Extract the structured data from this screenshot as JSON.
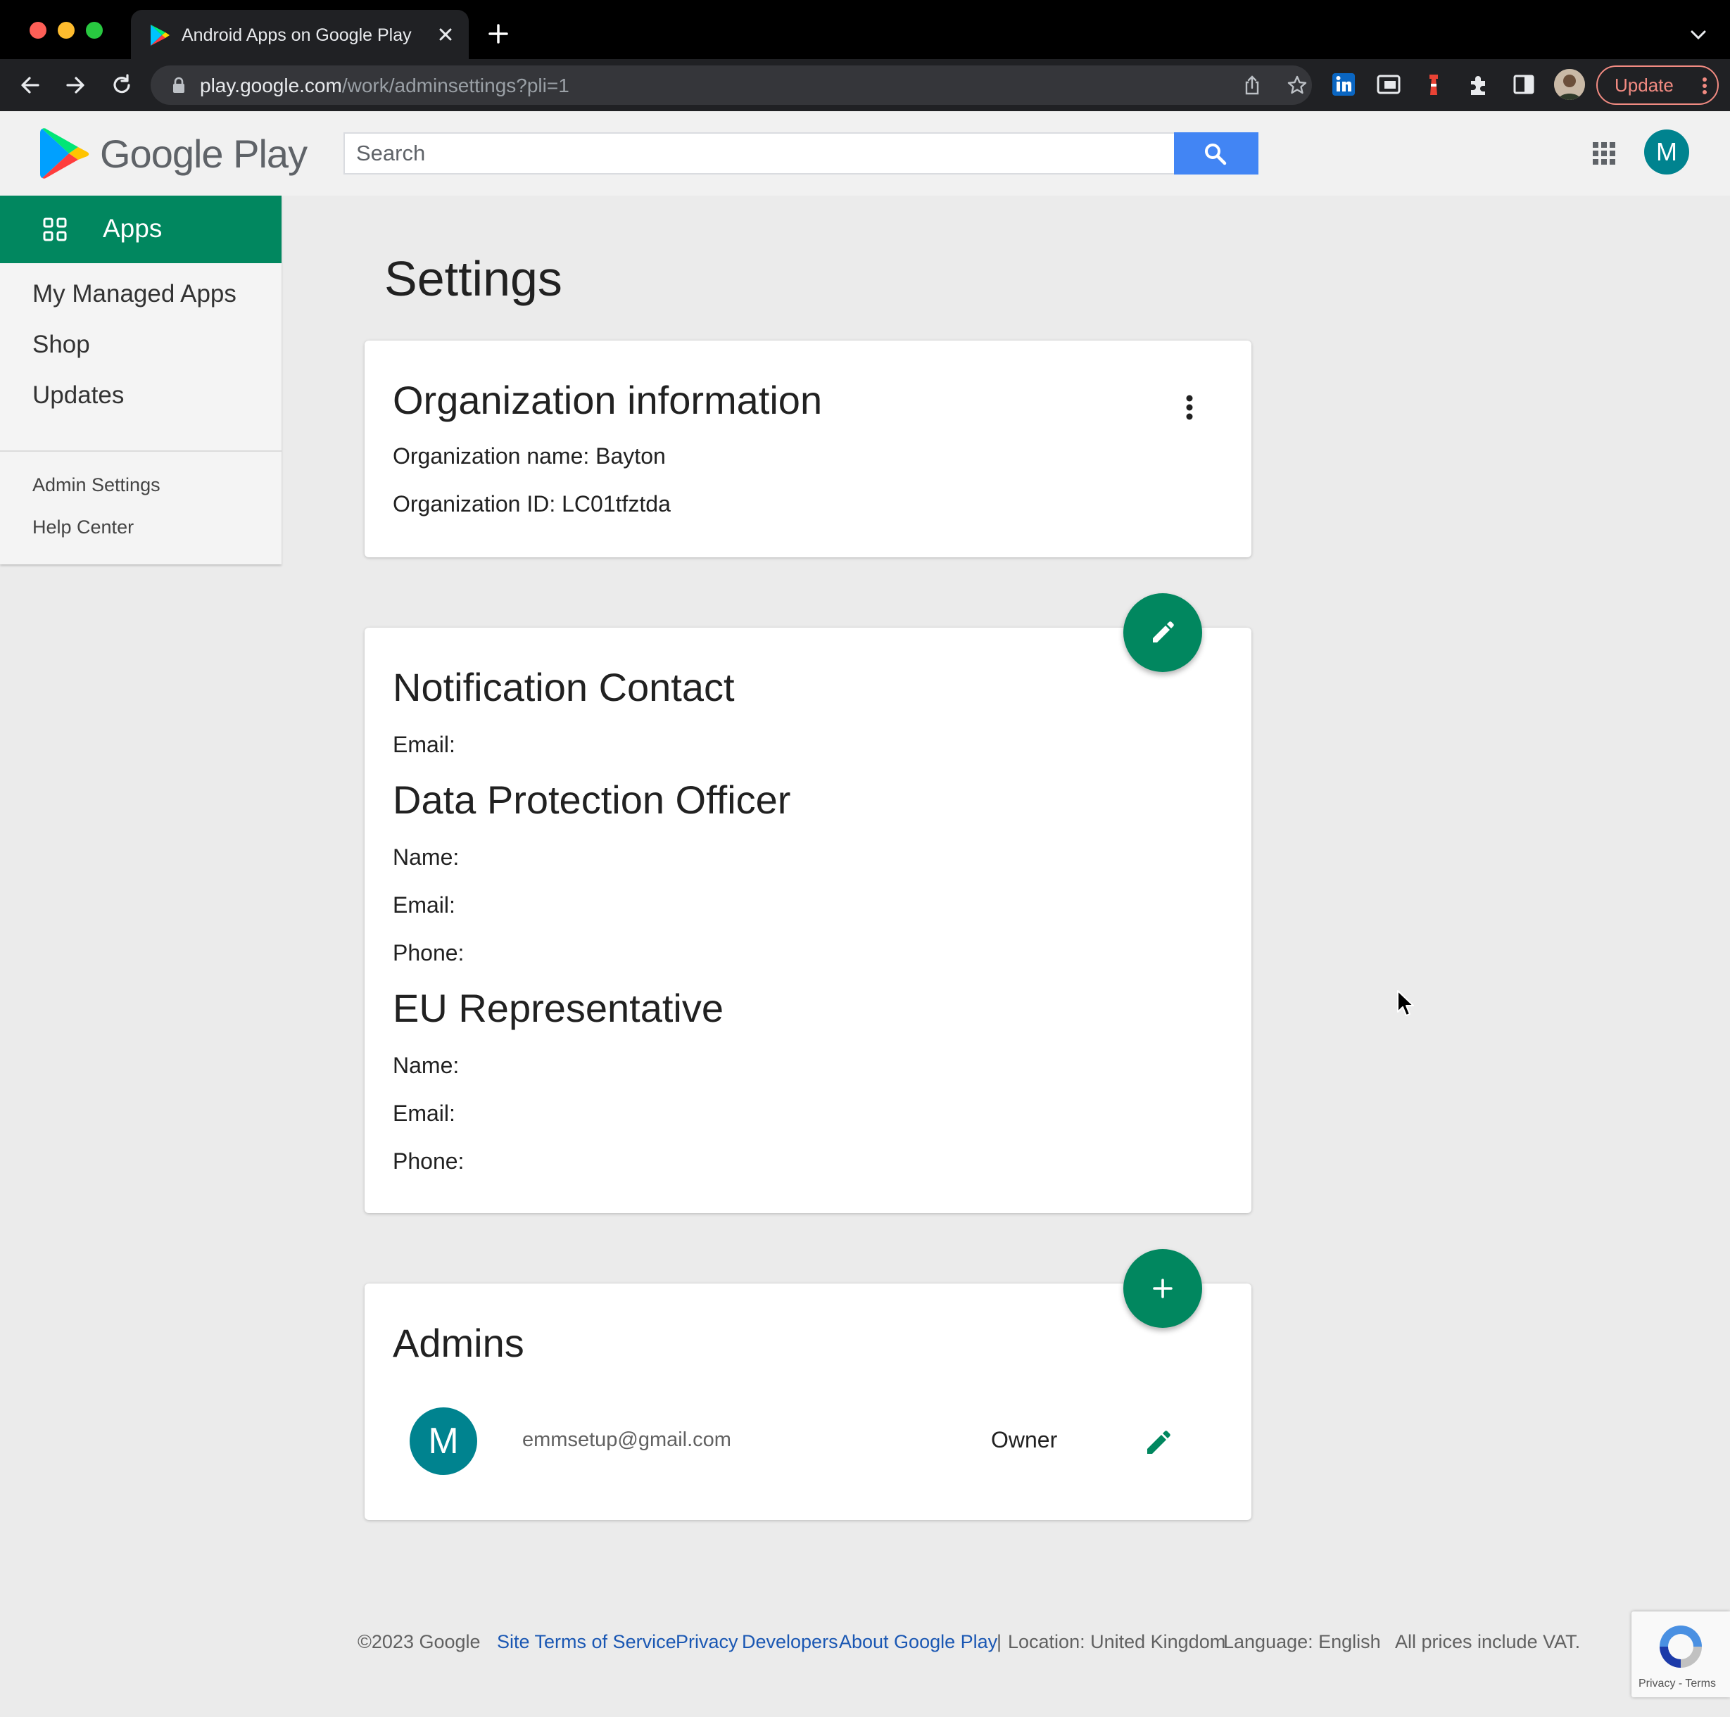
{
  "browser": {
    "tab_title": "Android Apps on Google Play",
    "url_host": "play.google.com",
    "url_path": "/work/adminsettings?pli=1",
    "update_label": "Update"
  },
  "header": {
    "logo_text": "Google Play",
    "search_placeholder": "Search",
    "avatar_initial": "M"
  },
  "sidenav": {
    "section_label": "Apps",
    "items": [
      {
        "label": "My Managed Apps"
      },
      {
        "label": "Shop"
      },
      {
        "label": "Updates"
      }
    ],
    "secondary": [
      {
        "label": "Admin Settings"
      },
      {
        "label": "Help Center"
      }
    ]
  },
  "main": {
    "title": "Settings",
    "org": {
      "heading": "Organization information",
      "name_line": "Organization name: Bayton",
      "id_line": "Organization ID: LC01tfztda"
    },
    "contacts": {
      "notification_heading": "Notification Contact",
      "notification_email": "Email:",
      "dpo_heading": "Data Protection Officer",
      "dpo_name": "Name:",
      "dpo_email": "Email:",
      "dpo_phone": "Phone:",
      "eu_heading": "EU Representative",
      "eu_name": "Name:",
      "eu_email": "Email:",
      "eu_phone": "Phone:"
    },
    "admins": {
      "heading": "Admins",
      "rows": [
        {
          "initial": "M",
          "email": "emmsetup@gmail.com",
          "role": "Owner"
        }
      ]
    }
  },
  "footer": {
    "copyright": "©2023 Google",
    "links": [
      "Site Terms of Service",
      "Privacy",
      "Developers",
      "About Google Play"
    ],
    "separator": "|",
    "location": "Location: United Kingdom",
    "language": "Language: English",
    "vat": "All prices include VAT."
  },
  "recaptcha": {
    "text": "Privacy - Terms"
  },
  "colors": {
    "play_green": "#01875f",
    "search_blue": "#4285f4",
    "avatar_teal": "#00838f",
    "link_blue": "#1a57b3"
  }
}
